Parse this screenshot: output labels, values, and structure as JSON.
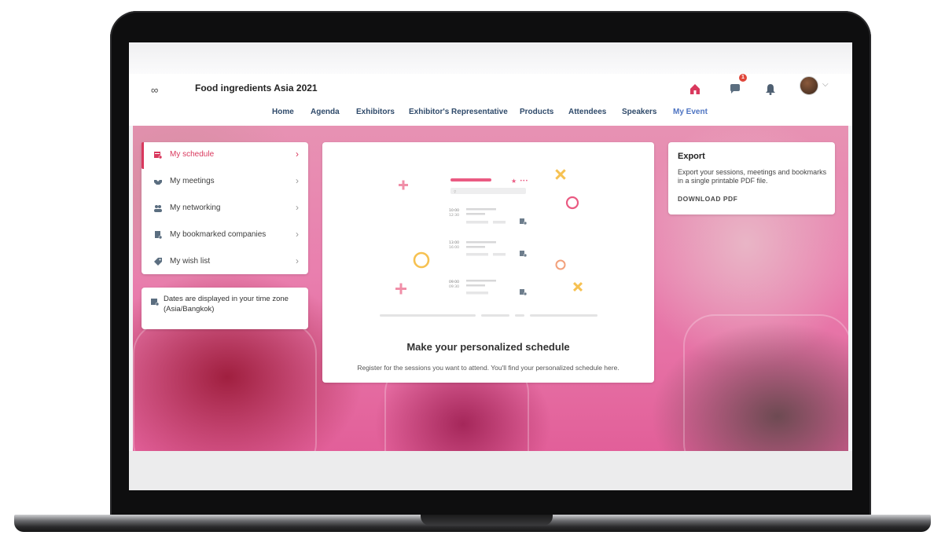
{
  "app": {
    "title": "Food ingredients Asia 2021",
    "logo": "∞"
  },
  "header": {
    "notification_count": "1"
  },
  "nav": [
    "Home",
    "Agenda",
    "Exhibitors",
    "Exhibitor's Representative",
    "Products",
    "Attendees",
    "Speakers",
    "My Event"
  ],
  "nav_active": "My Event",
  "menu": {
    "items": [
      {
        "label": "My schedule",
        "icon": "calendar-icon"
      },
      {
        "label": "My meetings",
        "icon": "handshake-icon"
      },
      {
        "label": "My networking",
        "icon": "people-icon"
      },
      {
        "label": "My bookmarked companies",
        "icon": "bookmark-icon"
      },
      {
        "label": "My wish list",
        "icon": "tag-icon"
      }
    ],
    "arrow": "›"
  },
  "timezone": {
    "text": "Dates are displayed in your time zone (Asia/Bangkok)"
  },
  "center": {
    "illustration_times": [
      "10:00",
      "13:00",
      "09:00"
    ],
    "illustration_times2": [
      "12:30",
      "16:00",
      "09:30"
    ],
    "title": "Make your personalized schedule",
    "subtitle": "Register for the sessions you want to attend. You'll find your personalized schedule here."
  },
  "export": {
    "title": "Export",
    "description": "Export your sessions, meetings and bookmarks in a single printable PDF file.",
    "button": "DOWNLOAD PDF"
  },
  "colors": {
    "accent": "#d9385d",
    "nav_active": "#4e74c2"
  }
}
